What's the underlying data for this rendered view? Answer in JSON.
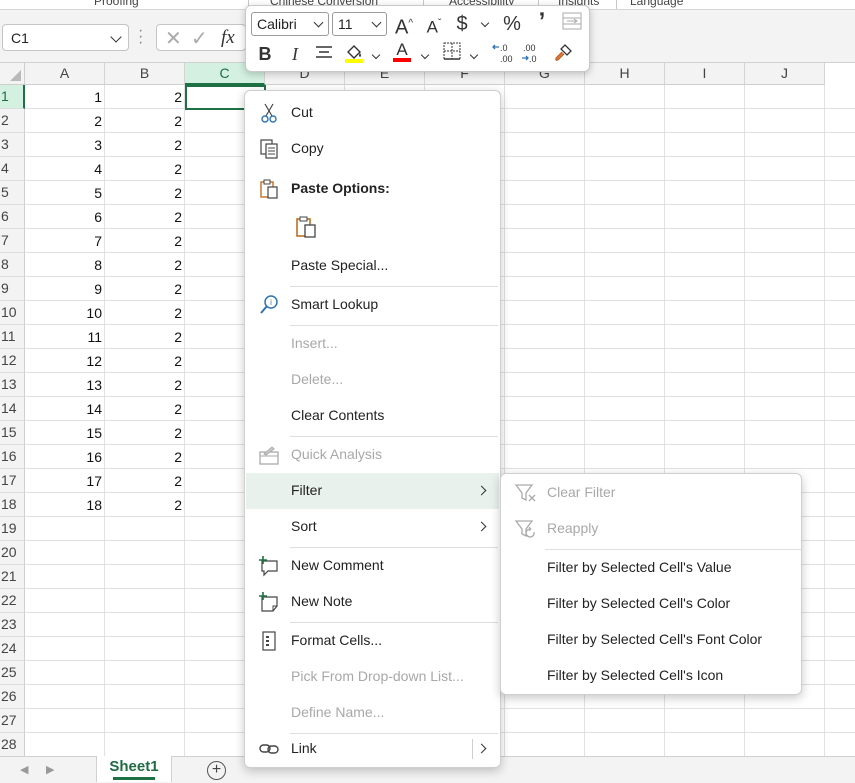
{
  "ribbon_groups": [
    "Proofing",
    "Chinese Conversion",
    "Accessibility",
    "Insights",
    "Language"
  ],
  "formula_bar": {
    "name_box": "C1",
    "cancel_icon": "x-icon",
    "enter_icon": "check-icon",
    "fx_label": "fx",
    "value": ""
  },
  "columns": [
    "A",
    "B",
    "C",
    "D",
    "E",
    "F",
    "G",
    "H",
    "I",
    "J"
  ],
  "selected_column": "C",
  "selected_row": "1",
  "rows": [
    "1",
    "2",
    "3",
    "4",
    "5",
    "6",
    "7",
    "8",
    "9",
    "10",
    "11",
    "12",
    "13",
    "14",
    "15",
    "16",
    "17",
    "18",
    "19",
    "20",
    "21",
    "22",
    "23",
    "24",
    "25",
    "26",
    "27",
    "28"
  ],
  "col_a_values": [
    "1",
    "2",
    "3",
    "4",
    "5",
    "6",
    "7",
    "8",
    "9",
    "10",
    "11",
    "12",
    "13",
    "14",
    "15",
    "16",
    "17",
    "18"
  ],
  "col_b_values": [
    "2",
    "2",
    "2",
    "2",
    "2",
    "2",
    "2",
    "2",
    "2",
    "2",
    "2",
    "2",
    "2",
    "2",
    "2",
    "2",
    "2",
    "2"
  ],
  "mini_toolbar": {
    "font_name": "Calibri",
    "font_size": "11",
    "grow_font": "A",
    "shrink_font": "A",
    "currency": "$",
    "percent": "%",
    "comma": "ʼ",
    "bold": "B",
    "italic": "I",
    "font_color_letter": "A",
    "fill_color": "#FFFF00",
    "font_color": "#FF0000"
  },
  "context_menu": {
    "cut": "Cut",
    "copy": "Copy",
    "paste_options": "Paste Options:",
    "paste_special": "Paste Special...",
    "smart_lookup": "Smart Lookup",
    "insert": "Insert...",
    "delete": "Delete...",
    "clear_contents": "Clear Contents",
    "quick_analysis": "Quick Analysis",
    "filter": "Filter",
    "sort": "Sort",
    "new_comment": "New Comment",
    "new_note": "New Note",
    "format_cells": "Format Cells...",
    "pick_from_list": "Pick From Drop-down List...",
    "define_name": "Define Name...",
    "link": "Link"
  },
  "filter_submenu": {
    "clear_filter": "Clear Filter",
    "reapply": "Reapply",
    "by_value": "Filter by Selected Cell's Value",
    "by_color": "Filter by Selected Cell's Color",
    "by_font_color": "Filter by Selected Cell's Font Color",
    "by_icon": "Filter by Selected Cell's Icon"
  },
  "sheet_tabs": {
    "active": "Sheet1",
    "add_icon": "plus-circle-icon"
  },
  "colors": {
    "accent_green": "#1E7145",
    "highlight_row": "#E8F1EC"
  }
}
